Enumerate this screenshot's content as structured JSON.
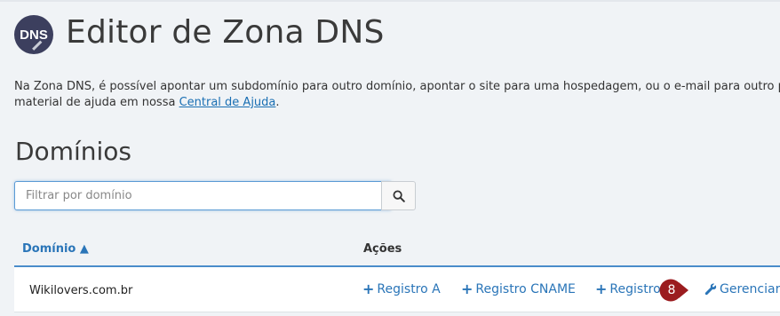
{
  "header": {
    "logo_text": "DNS",
    "title": "Editor de Zona DNS"
  },
  "intro": {
    "line1": "Na Zona DNS, é possível apontar um subdomínio para outro domínio, apontar o site para uma hospedagem, ou o e-mail para outro p",
    "line2_prefix": "material de ajuda em nossa ",
    "help_link": "Central de Ajuda",
    "line2_suffix": "."
  },
  "domains_section": {
    "title": "Domínios",
    "search": {
      "placeholder": "Filtrar por domínio",
      "value": ""
    },
    "search_icon": "search-icon"
  },
  "table": {
    "columns": [
      "Domínio ▲",
      "Ações"
    ],
    "rows": [
      {
        "domain": "Wikilovers.com.br",
        "actions": [
          {
            "icon": "plus-icon",
            "label": "Registro A"
          },
          {
            "icon": "plus-icon",
            "label": "Registro CNAME"
          },
          {
            "icon": "plus-icon",
            "label": "Registro"
          },
          {
            "icon": "wrench-icon",
            "label": "Gerenciar"
          }
        ]
      }
    ]
  },
  "annotation": {
    "step": "8",
    "color": "#9b1c1f"
  },
  "colors": {
    "accent": "#2a75b8",
    "header_line": "#4a8cca",
    "background": "#f0f3f6"
  }
}
